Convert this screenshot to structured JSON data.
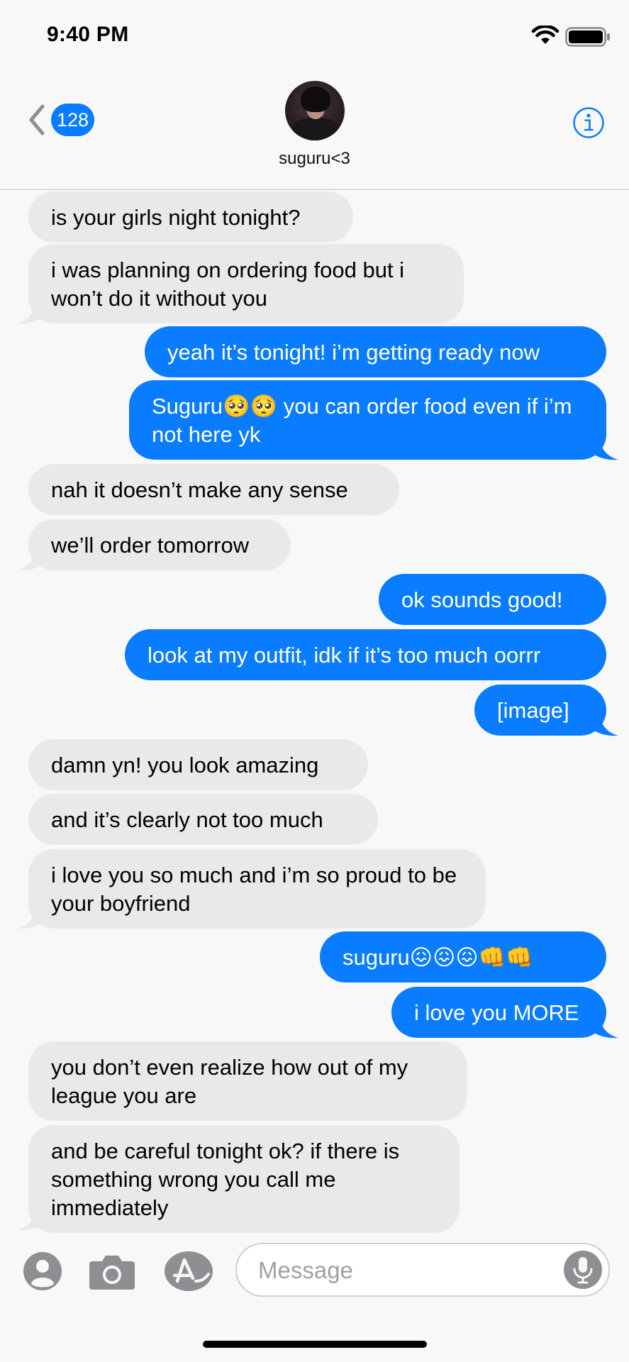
{
  "status_bar": {
    "time": "9:40 PM"
  },
  "header": {
    "unread_count": "128",
    "contact_name": "suguru<3"
  },
  "messages": [
    {
      "sender": "them",
      "text": "is your girls night tonight?"
    },
    {
      "sender": "them",
      "text": "i was planning on ordering food but i won’t do it without you"
    },
    {
      "sender": "me",
      "text": "yeah it’s tonight! i’m getting ready now"
    },
    {
      "sender": "me",
      "text": "Suguru🥺🥺 you can order food even if i’m not here yk"
    },
    {
      "sender": "them",
      "text": "nah it doesn’t make any sense"
    },
    {
      "sender": "them",
      "text": "we’ll order tomorrow"
    },
    {
      "sender": "me",
      "text": "ok sounds good!"
    },
    {
      "sender": "me",
      "text": "look at my outfit, idk if it’s too much oorrr"
    },
    {
      "sender": "me",
      "text": "[image]"
    },
    {
      "sender": "them",
      "text": "damn yn! you look amazing"
    },
    {
      "sender": "them",
      "text": "and it’s clearly not too much"
    },
    {
      "sender": "them",
      "text": "i love you so much and i’m so proud to be your boyfriend"
    },
    {
      "sender": "me",
      "text": "suguru😖😖😖👊👊"
    },
    {
      "sender": "me",
      "text": "i love you MORE"
    },
    {
      "sender": "them",
      "text": "you don’t even realize how out of my league you are"
    },
    {
      "sender": "them",
      "text": "and be careful tonight ok? if there is something wrong you call me immediately"
    }
  ],
  "input": {
    "placeholder": "Message",
    "value": ""
  },
  "colors": {
    "outgoing_bubble": "#0a7cff",
    "incoming_bubble": "#e9e9eb",
    "accent": "#0a7cff"
  },
  "icons": {
    "back": "chevron-left-icon",
    "info": "info-icon",
    "contacts": "contacts-icon",
    "camera": "camera-icon",
    "app_store": "app-store-icon",
    "mic": "mic-icon",
    "wifi": "wifi-icon",
    "battery": "battery-icon"
  }
}
